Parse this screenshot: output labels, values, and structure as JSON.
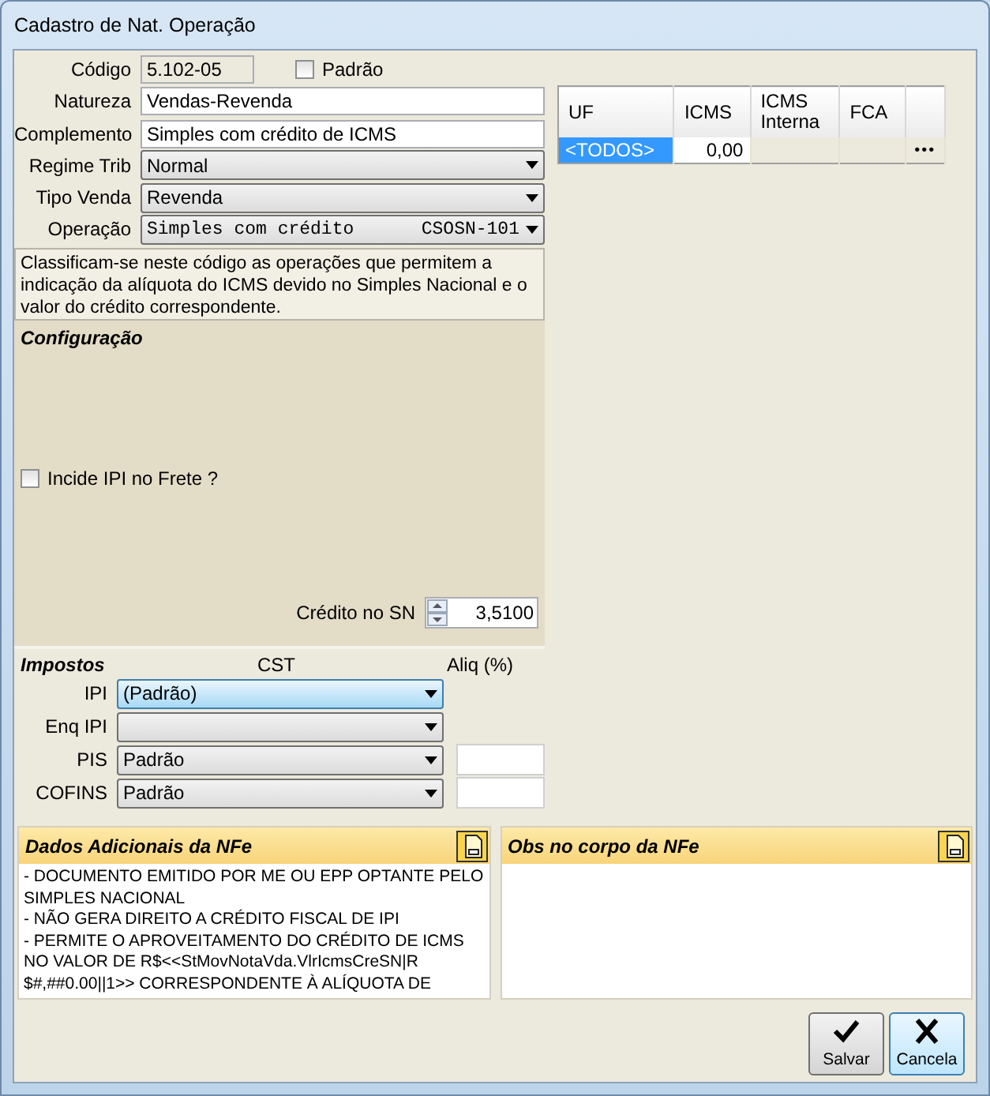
{
  "window": {
    "title": "Cadastro de Nat. Operação"
  },
  "codigo": {
    "label": "Código",
    "value": "5.102-05"
  },
  "padrao": {
    "label": "Padrão",
    "checked": false
  },
  "fields": [
    {
      "kind": "text",
      "label": "Natureza",
      "value": "Vendas-Revenda"
    },
    {
      "kind": "text",
      "label": "Complemento",
      "value": "Simples com crédito de ICMS"
    },
    {
      "kind": "select",
      "label": "Regime Trib",
      "value": "Normal"
    },
    {
      "kind": "select",
      "label": "Tipo Venda",
      "value": "Revenda"
    },
    {
      "kind": "select-code",
      "label": "Operação",
      "value": "Simples com crédito",
      "code": "CSOSN-101"
    }
  ],
  "description": "Classificam-se neste código as operações que permitem a indicação da alíquota do ICMS devido no Simples Nacional e o valor do crédito correspondente.",
  "configuracao": {
    "title": "Configuração",
    "incide_ipi": {
      "label": "Incide IPI no Frete ?",
      "checked": false
    },
    "credito": {
      "label": "Crédito no SN",
      "value": "3,5100"
    }
  },
  "impostos": {
    "title": "Impostos",
    "columns": [
      "CST",
      "Aliq (%)"
    ],
    "rows": [
      {
        "label": "IPI",
        "value": "(Padrão)",
        "focused": true,
        "kind": "select"
      },
      {
        "label": "Enq IPI",
        "focused": false,
        "kind": "select"
      },
      {
        "label": "PIS",
        "value": "Padrão",
        "focused": false,
        "kind": "select-aliq"
      },
      {
        "label": "COFINS",
        "value": "Padrão",
        "focused": false,
        "kind": "select-aliq"
      }
    ]
  },
  "uf_table": {
    "columns": [
      "UF",
      "ICMS",
      "ICMS\nInterna",
      "FCA"
    ],
    "rows": [
      {
        "uf": "<TODOS>",
        "icms": "0,00",
        "selected": true,
        "more": "•••"
      }
    ]
  },
  "panels": [
    {
      "title": "Dados Adicionais da NFe",
      "lines": [
        "- DOCUMENTO EMITIDO POR ME OU EPP OPTANTE PELO",
        "SIMPLES NACIONAL",
        "- NÃO GERA DIREITO A CRÉDITO FISCAL DE IPI",
        "- PERMITE O APROVEITAMENTO DO CRÉDITO DE ICMS",
        "NO VALOR DE R$<<StMovNotaVda.VlrIcmsCreSN|R",
        "$#,##0.00||1>> CORRESPONDENTE À ALÍQUOTA DE"
      ]
    },
    {
      "title": "Obs no corpo da NFe"
    }
  ],
  "buttons": [
    {
      "kind": "save",
      "label": "Salvar",
      "focused": false
    },
    {
      "kind": "cancel",
      "label": "Cancela",
      "focused": true
    }
  ]
}
